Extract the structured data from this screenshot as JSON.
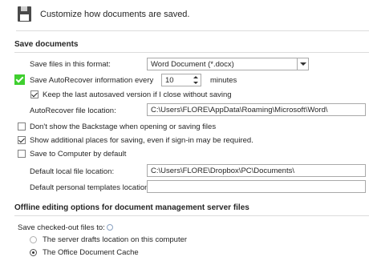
{
  "header": {
    "title": "Customize how documents are saved."
  },
  "save_documents": {
    "title": "Save documents",
    "format_label": "Save files in this format:",
    "format_value": "Word Document (*.docx)",
    "autorecover_label": "Save AutoRecover information every",
    "autorecover_checked": true,
    "autorecover_minutes": "10",
    "minutes_label": "minutes",
    "keep_last_label": "Keep the last autosaved version if I close without saving",
    "keep_last_checked": true,
    "autorecover_location_label": "AutoRecover file location:",
    "autorecover_location_value": "C:\\Users\\FLORE\\AppData\\Roaming\\Microsoft\\Word\\",
    "backstage_label": "Don't show the Backstage when opening or saving files",
    "backstage_checked": false,
    "additional_places_label": "Show additional places for saving, even if sign-in may be required.",
    "additional_places_checked": true,
    "save_to_computer_label": "Save to Computer by default",
    "save_to_computer_checked": false,
    "default_local_label": "Default local file location:",
    "default_local_value": "C:\\Users\\FLORE\\Dropbox\\PC\\Documents\\",
    "default_templates_label": "Default personal templates location:",
    "default_templates_value": ""
  },
  "offline": {
    "title": "Offline editing options for document management server files",
    "checked_out_label": "Save checked-out files to:",
    "option_server_drafts": "The server drafts location on this computer",
    "option_office_cache": "The Office Document Cache"
  },
  "colors": {
    "highlight_green": "#3fcf2f"
  }
}
